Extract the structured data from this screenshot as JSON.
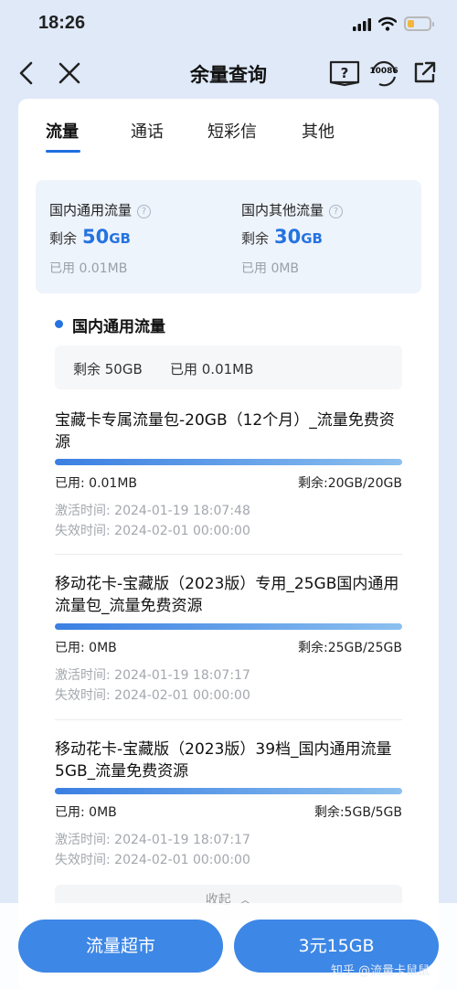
{
  "status_bar": {
    "time": "18:26"
  },
  "nav": {
    "title": "余量查询",
    "service_badge": "10086"
  },
  "tabs": [
    "流量",
    "通话",
    "短彩信",
    "其他"
  ],
  "summary": {
    "left": {
      "label": "国内通用流量",
      "remain_prefix": "剩余",
      "remain_value": "50",
      "remain_unit": "GB",
      "used": "已用 0.01MB"
    },
    "right": {
      "label": "国内其他流量",
      "remain_prefix": "剩余",
      "remain_value": "30",
      "remain_unit": "GB",
      "used": "已用 0MB"
    }
  },
  "section": {
    "title": "国内通用流量",
    "remain": "剩余 50GB",
    "used": "已用 0.01MB"
  },
  "packages": [
    {
      "name": "宝藏卡专属流量包-20GB（12个月）_流量免费资源",
      "usage_fraction": 1.0,
      "used": "已用: 0.01MB",
      "remain": "剩余:20GB/20GB",
      "activated": "激活时间: 2024-01-19 18:07:48",
      "expires": "失效时间: 2024-02-01 00:00:00"
    },
    {
      "name": "移动花卡-宝藏版（2023版）专用_25GB国内通用流量包_流量免费资源",
      "usage_fraction": 1.0,
      "used": "已用: 0MB",
      "remain": "剩余:25GB/25GB",
      "activated": "激活时间: 2024-01-19 18:07:17",
      "expires": "失效时间: 2024-02-01 00:00:00"
    },
    {
      "name": "移动花卡-宝藏版（2023版）39档_国内通用流量5GB_流量免费资源",
      "usage_fraction": 1.0,
      "used": "已用: 0MB",
      "remain": "剩余:5GB/5GB",
      "activated": "激活时间: 2024-01-19 18:07:17",
      "expires": "失效时间: 2024-02-01 00:00:00"
    }
  ],
  "collapse_label": "收起",
  "bottom": {
    "market_button": "流量超市",
    "offer_button": "3元15GB"
  },
  "watermark": "知乎 @流量卡鼠鼠",
  "colors": {
    "accent": "#2573e0",
    "button": "#3d87e6",
    "page_bg": "#dfe9f8"
  }
}
